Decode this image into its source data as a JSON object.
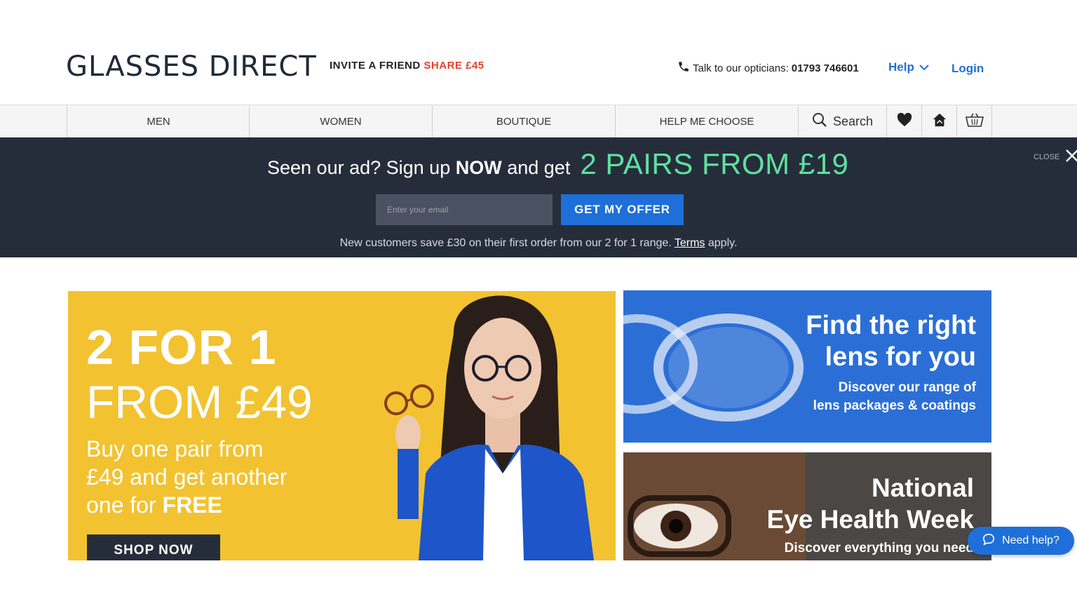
{
  "header": {
    "logo": "GLASSES DIRECT",
    "invite_text": "INVITE A FRIEND",
    "invite_share": "SHARE £45",
    "phone_label": "Talk to our opticians:",
    "phone_number": "01793 746601",
    "help_label": "Help",
    "login_label": "Login"
  },
  "nav": {
    "items": [
      {
        "label": "MEN"
      },
      {
        "label": "WOMEN"
      },
      {
        "label": "BOUTIQUE"
      },
      {
        "label": "HELP ME CHOOSE"
      }
    ],
    "search_label": "Search",
    "icons": [
      "search-icon",
      "heart-icon",
      "home-try-on-icon",
      "basket-icon"
    ]
  },
  "promo": {
    "lead_start": "Seen our ad? Sign up",
    "lead_now": "NOW",
    "lead_end": "and get",
    "headline": "2 PAIRS FROM £19",
    "close_label": "CLOSE",
    "email_placeholder": "Enter your email",
    "offer_button": "GET MY OFFER",
    "note_start": "New customers save £30 on their first order from our 2 for 1 range.",
    "note_terms": "Terms",
    "note_end": "apply.",
    "colors": {
      "background": "#262d3a",
      "accent": "#5ee0a0",
      "button": "#1e6fd9"
    }
  },
  "hero": {
    "title": "2 FOR 1",
    "subtitle": "FROM £49",
    "body_line1": "Buy one pair from",
    "body_line2": "£49 and  get another",
    "body_line3_start": "one for",
    "body_line3_bold": "FREE",
    "button": "SHOP NOW",
    "colors": {
      "background": "#f2c230"
    }
  },
  "lens_banner": {
    "title_line1": "Find the right",
    "title_line2": "lens for you",
    "sub_line1": "Discover our range of",
    "sub_line2": "lens packages & coatings",
    "colors": {
      "background": "#2b6fd6"
    }
  },
  "eye_banner": {
    "title_line1": "National",
    "title_line2": "Eye Health Week",
    "sub": "Discover everything you need"
  },
  "chat": {
    "label": "Need help?"
  }
}
